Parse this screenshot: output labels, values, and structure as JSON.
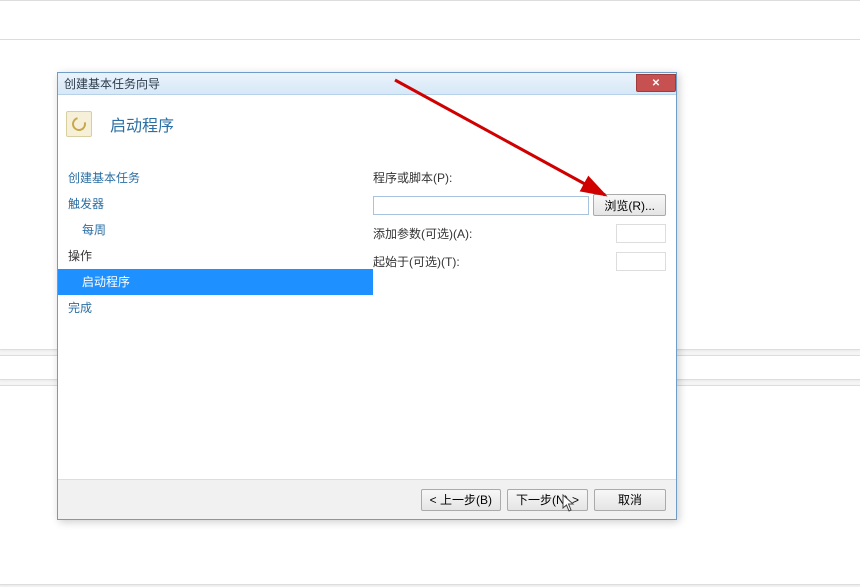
{
  "window": {
    "title": "创建基本任务向导",
    "close_glyph": "✕"
  },
  "header": {
    "title": "启动程序"
  },
  "sidebar": {
    "items": [
      {
        "label": "创建基本任务"
      },
      {
        "label": "触发器"
      },
      {
        "label": "每周"
      },
      {
        "label": "操作"
      },
      {
        "label": "启动程序"
      },
      {
        "label": "完成"
      }
    ]
  },
  "form": {
    "program_label": "程序或脚本(P):",
    "program_value": "",
    "browse_label": "浏览(R)...",
    "args_label": "添加参数(可选)(A):",
    "args_value": "",
    "startin_label": "起始于(可选)(T):",
    "startin_value": ""
  },
  "footer": {
    "back": "< 上一步(B)",
    "next": "下一步(N) >",
    "cancel": "取消"
  }
}
